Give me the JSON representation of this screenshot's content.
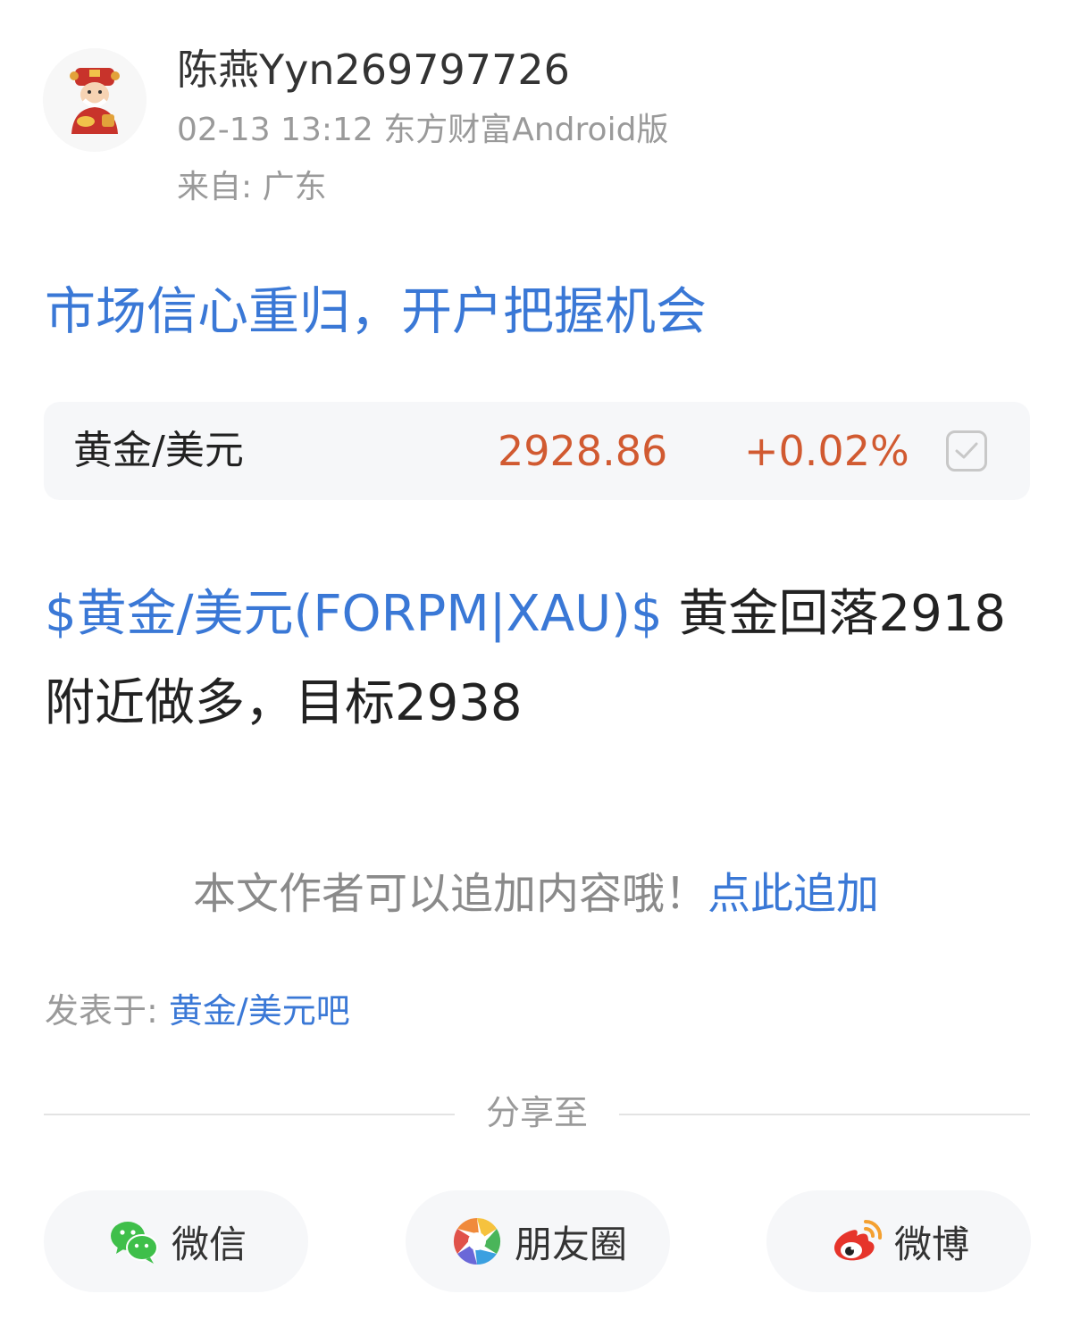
{
  "author": {
    "name": "陈燕Yyn269797726",
    "meta": "02-13 13:12 东方财富Android版",
    "location": "来自: 广东"
  },
  "post": {
    "title": "市场信心重归，开户把握机会",
    "body_link": "$黄金/美元(FORPM|XAU)$",
    "body_text": " 黄金回落2918附近做多，目标2938"
  },
  "quote": {
    "name": "黄金/美元",
    "price": "2928.86",
    "change": "+0.02%",
    "color": "#d15a31"
  },
  "append": {
    "note": "本文作者可以追加内容哦！",
    "link": "点此追加"
  },
  "posted_in": {
    "label": "发表于: ",
    "forum": "黄金/美元吧"
  },
  "share": {
    "label": "分享至",
    "buttons": [
      {
        "label": "微信",
        "icon": "wechat-icon"
      },
      {
        "label": "朋友圈",
        "icon": "moments-icon"
      },
      {
        "label": "微博",
        "icon": "weibo-icon"
      }
    ]
  },
  "colors": {
    "accent": "#3a78d6",
    "price_up": "#d15a31"
  }
}
